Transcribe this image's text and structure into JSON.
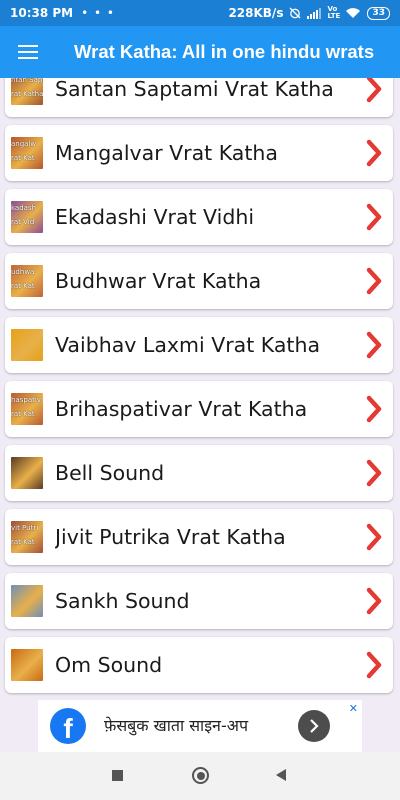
{
  "status_bar": {
    "time": "10:38 PM",
    "dots": "• • •",
    "speed": "228KB/s",
    "network": "Vo LTE",
    "battery": "33"
  },
  "app_bar": {
    "menu_icon": "hamburger-menu-icon",
    "title": "Wrat Katha: All in one hindu wrats"
  },
  "list": {
    "items": [
      {
        "label": "Santan Saptami Vrat Katha",
        "thumb_text": [
          "ntan Sapta",
          "rat Katha"
        ],
        "thumb_color": "#a0522d"
      },
      {
        "label": "Mangalvar Vrat Katha",
        "thumb_text": [
          "angalw",
          "rat Kat"
        ],
        "thumb_color": "#b5542d"
      },
      {
        "label": "Ekadashi Vrat Vidhi",
        "thumb_text": [
          "kadash",
          "rat Vid"
        ],
        "thumb_color": "#8a4b9c"
      },
      {
        "label": "Budhwar Vrat Katha",
        "thumb_text": [
          "udhwa",
          "rat Kat"
        ],
        "thumb_color": "#c0623a"
      },
      {
        "label": "Vaibhav Laxmi Vrat Katha",
        "thumb_text": [],
        "thumb_color": "#e6a11a"
      },
      {
        "label": "Brihaspativar Vrat Katha",
        "thumb_text": [
          "haspativ",
          "rat Kat"
        ],
        "thumb_color": "#b85a34"
      },
      {
        "label": "Bell Sound",
        "thumb_text": [],
        "thumb_color": "#5a3a22"
      },
      {
        "label": "Jivit Putrika Vrat Katha",
        "thumb_text": [
          "vit Putri",
          "rat Kat"
        ],
        "thumb_color": "#a24d3a"
      },
      {
        "label": "Sankh Sound",
        "thumb_text": [],
        "thumb_color": "#6f8fb8"
      },
      {
        "label": "Om Sound",
        "thumb_text": [],
        "thumb_color": "#c96a12"
      }
    ],
    "chevron_color": "#e53935"
  },
  "ad": {
    "icon": "facebook-icon",
    "text": "फ़ेसबुक खाता साइन-अप",
    "button_icon": "chevron-right-icon",
    "close_icon": "ad-choices-close-icon"
  },
  "colors": {
    "status_bar": "#1b7fd4",
    "app_bar": "#2196f3",
    "background": "#f0ebf5"
  }
}
